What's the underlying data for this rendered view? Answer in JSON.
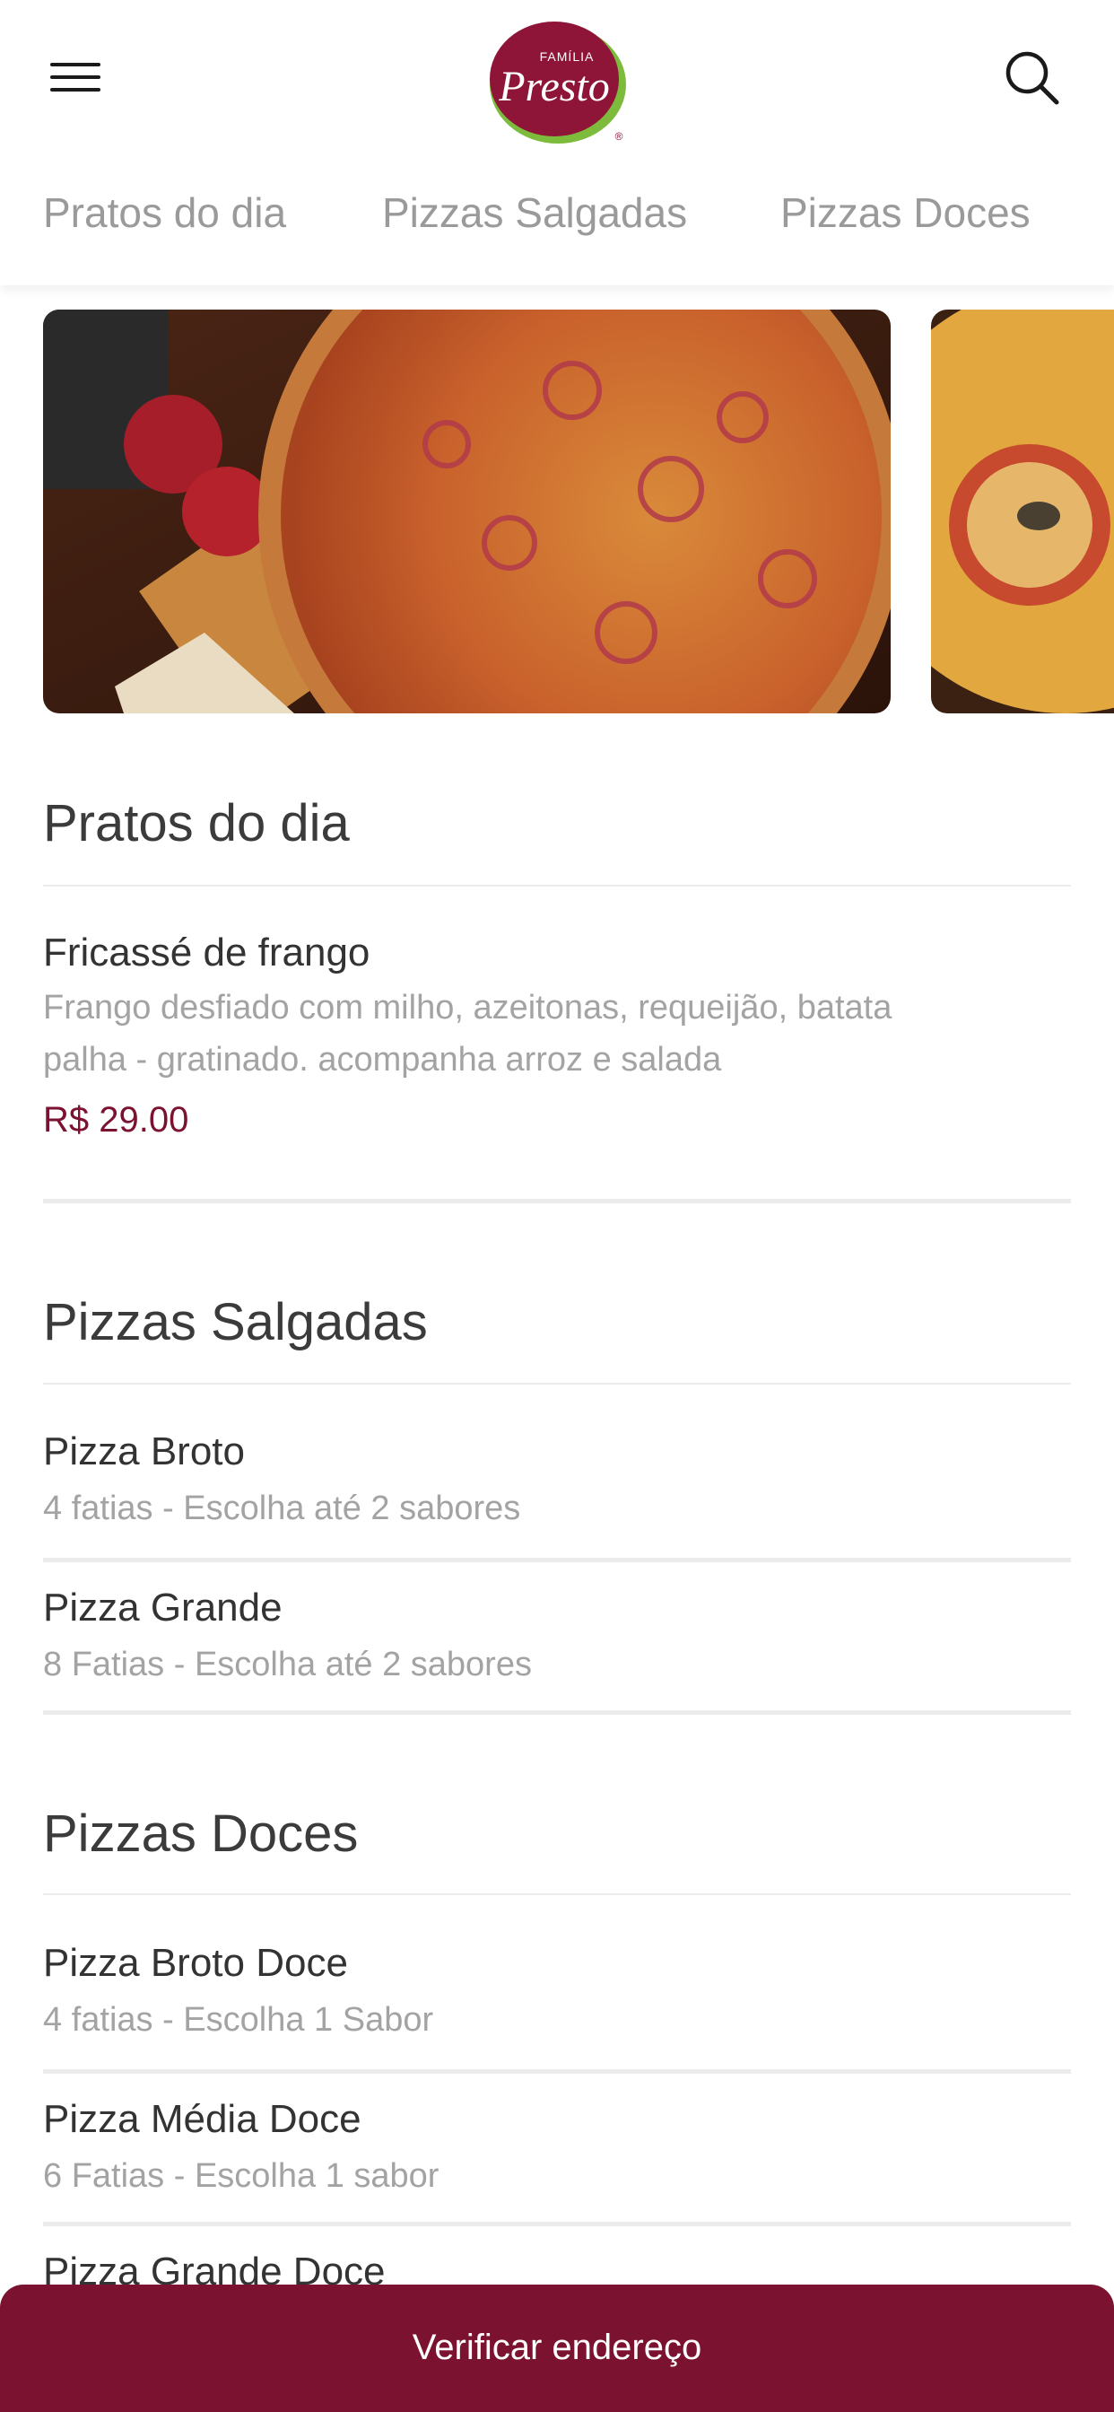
{
  "header": {
    "logo_text_small": "FAMÍLIA",
    "logo_text_big": "Presto",
    "logo_reg": "®"
  },
  "tabs": [
    {
      "label": "Pratos do dia"
    },
    {
      "label": "Pizzas Salgadas"
    },
    {
      "label": "Pizzas Doces"
    }
  ],
  "sections": {
    "pratos": {
      "title": "Pratos do dia",
      "items": [
        {
          "name": "Fricassé de frango",
          "description_line1": "Frango desfiado com milho, azeitonas, requeijão, batata",
          "description_line2": "palha - gratinado. acompanha arroz e salada",
          "price": "R$ 29.00"
        }
      ]
    },
    "salgadas": {
      "title": "Pizzas Salgadas",
      "items": [
        {
          "name": "Pizza Broto",
          "description": "4 fatias - Escolha até 2 sabores"
        },
        {
          "name": "Pizza Grande",
          "description": "8 Fatias - Escolha até 2 sabores"
        }
      ]
    },
    "doces": {
      "title": "Pizzas Doces",
      "items": [
        {
          "name": "Pizza Broto Doce",
          "description": "4 fatias - Escolha 1 Sabor"
        },
        {
          "name": "Pizza Média Doce",
          "description": "6 Fatias - Escolha 1 sabor"
        },
        {
          "name": "Pizza Grande Doce",
          "description": ""
        }
      ]
    }
  },
  "cta": {
    "label": "Verificar endereço"
  },
  "colors": {
    "brand": "#7b1230",
    "logo_green": "#7dbb3c",
    "muted_text": "#a3a3a3"
  }
}
